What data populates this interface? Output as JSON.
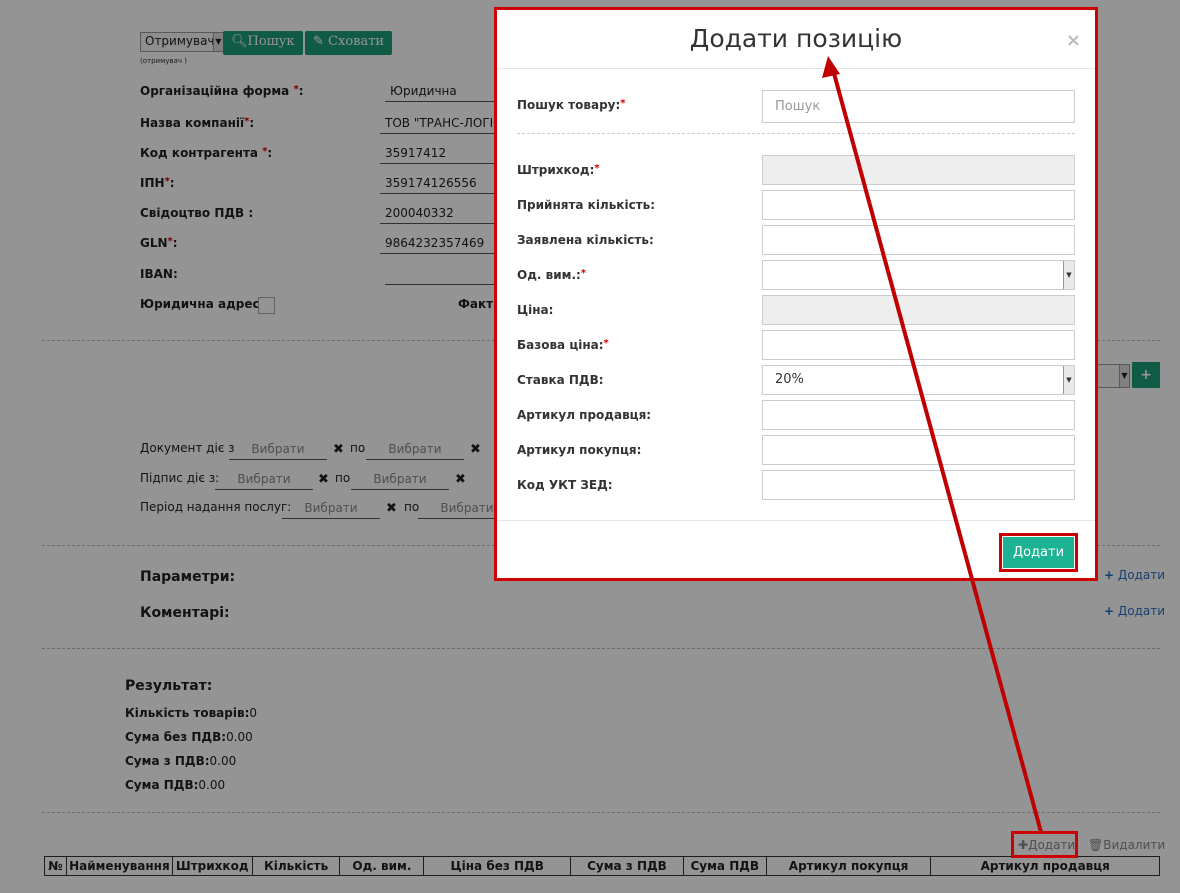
{
  "top": {
    "recipient_select": "Отримувач",
    "recipient_sub": "(отримувач )",
    "search_btn": "Пошук",
    "hide_btn": "Сховати"
  },
  "org": {
    "rows": [
      {
        "label": "Організаційна форма ",
        "req": "*",
        "suffix": ":",
        "value": "Юридична"
      },
      {
        "label": "Назва компанії",
        "req": "*",
        "suffix": ":",
        "value": "ТОВ  \"ТРАНС-ЛОГІС"
      },
      {
        "label": "Код контрагента ",
        "req": "*",
        "suffix": ":",
        "value": "35917412"
      },
      {
        "label": "ІПН",
        "req": "*",
        "suffix": ":",
        "value": "359174126556"
      },
      {
        "label": "Свідоцтво ПДВ :",
        "req": "",
        "suffix": "",
        "value": "200040332"
      },
      {
        "label": "GLN",
        "req": "*",
        "suffix": ":",
        "value": "9864232357469"
      },
      {
        "label": "IBAN:",
        "req": "",
        "suffix": "",
        "value": ""
      }
    ],
    "legal_address": "Юридична адреса:",
    "actual_address": "Факти"
  },
  "dates": {
    "doc_valid_from": "Документ діє з",
    "by": "по",
    "choose": "Вибрати",
    "sign_valid_from": "Підпис діє з:",
    "service_period": "Період надання послуг:"
  },
  "sections": {
    "params": "Параметри:",
    "comments": "Коментарі:",
    "add": "Додати"
  },
  "result": {
    "title": "Результат:",
    "items_count_label": "Кількість товарів:",
    "items_count": "0",
    "sum_no_vat_label": "Сума без ПДВ:",
    "sum_no_vat": "0.00",
    "sum_with_vat_label": "Сума з ПДВ:",
    "sum_with_vat": "0.00",
    "vat_sum_label": "Сума ПДВ:",
    "vat_sum": "0.00"
  },
  "table": {
    "add_btn": "Додати",
    "delete_btn": "Видалити",
    "columns": [
      "№",
      "Найменування",
      "Штрихкод",
      "Кількість",
      "Од. вим.",
      "Ціна без ПДВ",
      "Сума з ПДВ",
      "Сума ПДВ",
      "Артикул покупця",
      "Артикул продавця"
    ]
  },
  "modal": {
    "title": "Додати позицію",
    "close": "×",
    "search_label": "Пошук товару:",
    "search_placeholder": "Пошук",
    "fields": [
      {
        "label": "Штрихкод:",
        "req": "*",
        "value": "",
        "readonly": true
      },
      {
        "label": "Прийнята кількість:",
        "req": "",
        "value": "",
        "readonly": false
      },
      {
        "label": "Заявлена кількість:",
        "req": "",
        "value": "",
        "readonly": false
      },
      {
        "label": "Од. вим.:",
        "req": "*",
        "value": "",
        "readonly": false,
        "select": true
      },
      {
        "label": "Ціна:",
        "req": "",
        "value": "",
        "readonly": true
      },
      {
        "label": "Базова ціна:",
        "req": "*",
        "value": "",
        "readonly": false
      },
      {
        "label": "Ставка ПДВ:",
        "req": "",
        "value": "20%",
        "readonly": false,
        "select": true
      },
      {
        "label": "Артикул продавця:",
        "req": "",
        "value": "",
        "readonly": false
      },
      {
        "label": "Артикул покупця:",
        "req": "",
        "value": "",
        "readonly": false
      },
      {
        "label": "Код УКТ ЗЕД:",
        "req": "",
        "value": "",
        "readonly": false
      }
    ],
    "submit": "Додати"
  },
  "colors": {
    "teal": "#1a9e78",
    "modal_btn": "#1cb394",
    "annotation_red": "#c00000",
    "link_blue": "#2a6fc2"
  }
}
